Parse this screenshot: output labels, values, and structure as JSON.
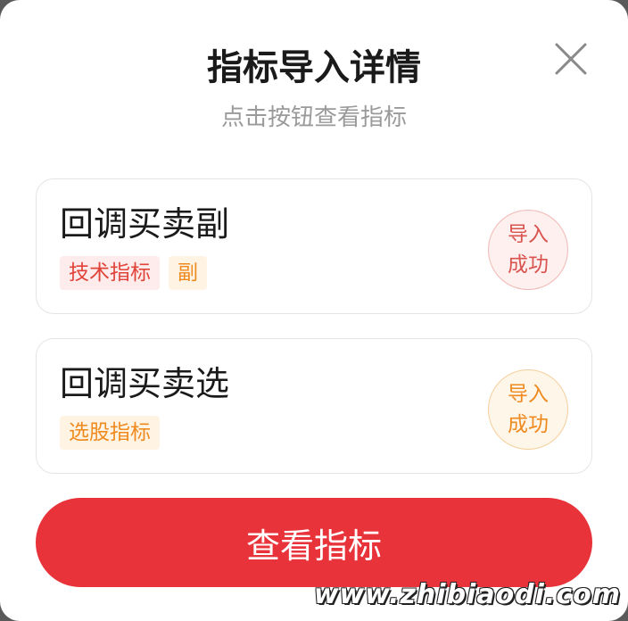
{
  "dialog": {
    "title": "指标导入详情",
    "subtitle": "点击按钮查看指标",
    "close_icon": "close-icon"
  },
  "indicators": [
    {
      "name": "回调买卖副",
      "tags": [
        "技术指标",
        "副"
      ],
      "status_line1": "导入",
      "status_line2": "成功"
    },
    {
      "name": "回调买卖选",
      "tags": [
        "选股指标"
      ],
      "status_line1": "导入",
      "status_line2": "成功"
    }
  ],
  "primary_button": {
    "label": "查看指标"
  },
  "watermark": "www.zhibiaodi.com",
  "colors": {
    "accent_red": "#e8333a",
    "tag_red": "#e0433a",
    "tag_orange": "#ee8a1e"
  }
}
